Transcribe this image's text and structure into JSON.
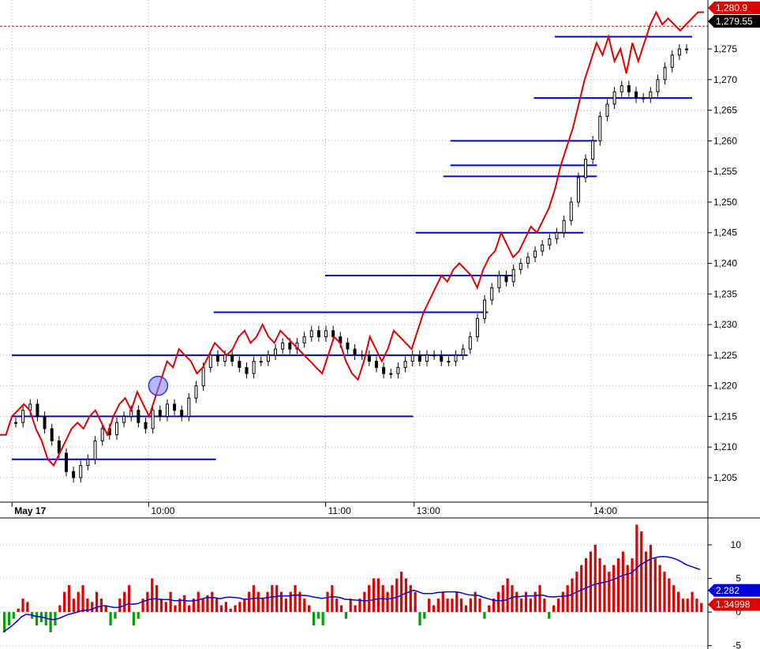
{
  "chart_data": [
    {
      "type": "candlestick",
      "panel": "price",
      "ylim": [
        1201,
        1283
      ],
      "y_ticks": [
        "1,205",
        "1,210",
        "1,215",
        "1,220",
        "1,225",
        "1,230",
        "1,235",
        "1,240",
        "1,245",
        "1,250",
        "1,255",
        "1,260",
        "1,265",
        "1,270",
        "1,275"
      ],
      "x_tick_labels": [
        "May 17",
        "10:00",
        "11:00",
        "13:00",
        "14:00"
      ],
      "grid": true,
      "last_price_label": "1,279.55",
      "red_line_label": "1,280.9",
      "colors": {
        "line": "#e00000",
        "levels": "#0000dd",
        "candle": "#000000",
        "marker": "#3333cc",
        "grid": "#b0b0b0",
        "dashed_ref": "#e00000"
      },
      "red_line": [
        1212,
        1212,
        1215,
        1216,
        1217,
        1216,
        1213,
        1211,
        1208,
        1207,
        1209,
        1211,
        1213,
        1214,
        1213,
        1215,
        1216,
        1214,
        1212,
        1215,
        1217,
        1218,
        1216,
        1219,
        1217,
        1215,
        1218,
        1221,
        1224,
        1223,
        1226,
        1225,
        1224,
        1222,
        1223,
        1225,
        1227,
        1226,
        1225,
        1226,
        1228,
        1229,
        1227,
        1228,
        1230,
        1228,
        1227,
        1229,
        1228,
        1227,
        1226,
        1225,
        1224,
        1223,
        1222,
        1225,
        1228,
        1227,
        1224,
        1222,
        1221,
        1224,
        1228,
        1226,
        1224,
        1226,
        1229,
        1228,
        1227,
        1226,
        1229,
        1232,
        1234,
        1236,
        1238,
        1237,
        1239,
        1240,
        1239,
        1238,
        1236,
        1239,
        1241,
        1242,
        1245,
        1243,
        1241,
        1242,
        1244,
        1246,
        1245,
        1247,
        1249,
        1252,
        1256,
        1259,
        1262,
        1266,
        1270,
        1273,
        1276,
        1274,
        1277,
        1273,
        1275,
        1271,
        1276,
        1273,
        1276,
        1279,
        1281,
        1279,
        1280,
        1279,
        1278,
        1279,
        1280,
        1281,
        1281
      ],
      "candles": [
        1214,
        1216,
        1217,
        1215,
        1213,
        1211,
        1209,
        1206,
        1205,
        1207,
        1208,
        1211,
        1213,
        1212,
        1214,
        1215,
        1216,
        1214,
        1213,
        1216,
        1215,
        1217,
        1216,
        1215,
        1218,
        1220,
        1223,
        1225,
        1224,
        1225,
        1224,
        1223,
        1222,
        1224,
        1224,
        1225,
        1226,
        1227,
        1226,
        1227,
        1228,
        1229,
        1228,
        1229,
        1228,
        1227,
        1226,
        1225,
        1225,
        1224,
        1223,
        1222,
        1222,
        1223,
        1224,
        1225,
        1224,
        1225,
        1225,
        1224,
        1224,
        1225,
        1226,
        1228,
        1231,
        1234,
        1236,
        1238,
        1237,
        1239,
        1240,
        1241,
        1242,
        1243,
        1244,
        1245,
        1247,
        1250,
        1254,
        1257,
        1260,
        1264,
        1266,
        1268,
        1269,
        1268,
        1267,
        1267,
        1268,
        1270,
        1272,
        1274,
        1275,
        1275
      ],
      "level_lines": [
        {
          "price": 1277,
          "from": 0.78,
          "to": 1.0
        },
        {
          "price": 1267,
          "from": 0.75,
          "to": 1.0
        },
        {
          "price": 1260,
          "from": 0.63,
          "to": 0.86
        },
        {
          "price": 1256,
          "from": 0.63,
          "to": 0.86
        },
        {
          "price": 1254.2,
          "from": 0.62,
          "to": 0.86
        },
        {
          "price": 1245,
          "from": 0.58,
          "to": 0.84
        },
        {
          "price": 1238,
          "from": 0.45,
          "to": 0.74
        },
        {
          "price": 1232,
          "from": 0.29,
          "to": 0.7
        },
        {
          "price": 1225,
          "from": 0.0,
          "to": 0.67
        },
        {
          "price": 1215,
          "from": 0.0,
          "to": 0.59
        },
        {
          "price": 1208,
          "from": 0.0,
          "to": 0.3
        }
      ],
      "marker": {
        "price": 1220,
        "x": 0.21
      }
    },
    {
      "type": "bar",
      "panel": "indicator",
      "ylim": [
        -5.5,
        14
      ],
      "y_ticks": [
        "-5",
        "0",
        "5",
        "10"
      ],
      "avg_label": "2.282",
      "last_label": "1.34998",
      "colors": {
        "positive": "#e00000",
        "negative": "#00a000",
        "average": "#0000dd"
      },
      "values": [
        -3,
        -2,
        -1,
        0.5,
        2,
        1.5,
        -1,
        -2,
        -1.5,
        -2,
        -3,
        -2,
        1,
        3,
        4,
        2,
        3,
        4,
        2,
        1.5,
        3,
        2,
        1,
        -2,
        -1,
        2,
        3,
        4,
        -2,
        -1,
        2,
        3,
        5,
        4,
        2,
        1.5,
        3,
        1,
        2,
        2.5,
        1,
        2,
        3,
        2,
        2.5,
        3,
        2,
        1,
        1.5,
        0.5,
        1,
        1.5,
        2,
        3,
        4,
        3,
        2,
        3,
        4,
        4,
        3,
        2,
        3,
        4,
        3,
        2,
        1,
        -2,
        -1,
        -2,
        3,
        4,
        2,
        1,
        -1,
        2,
        1,
        2,
        3,
        4,
        5,
        5,
        4,
        3,
        4,
        5,
        6,
        5,
        4,
        3,
        -2,
        -1,
        2,
        1,
        2,
        3,
        2,
        2,
        3,
        2,
        1,
        2,
        3,
        2,
        -1,
        1,
        2,
        3,
        4,
        5,
        4,
        3,
        2,
        3,
        2,
        3,
        4,
        2,
        -1,
        1,
        2,
        3,
        4,
        5,
        6,
        7,
        8,
        9,
        10,
        8,
        7,
        6,
        7,
        8,
        9,
        7,
        8,
        13,
        12,
        9,
        10,
        8,
        7,
        6,
        5,
        4,
        3,
        2,
        2,
        3,
        2,
        1.35
      ]
    }
  ]
}
